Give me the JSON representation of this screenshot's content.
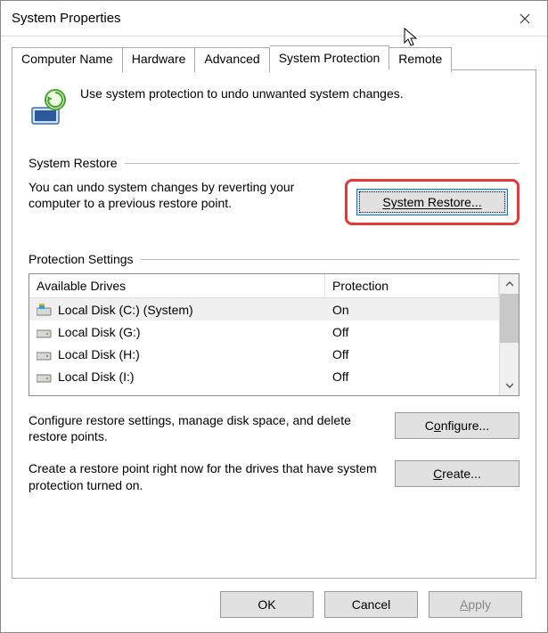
{
  "window": {
    "title": "System Properties"
  },
  "tabs": {
    "items": [
      {
        "label": "Computer Name"
      },
      {
        "label": "Hardware"
      },
      {
        "label": "Advanced"
      },
      {
        "label": "System Protection"
      },
      {
        "label": "Remote"
      }
    ],
    "active_index": 3
  },
  "intro": "Use system protection to undo unwanted system changes.",
  "restore_group": {
    "title": "System Restore",
    "text": "You can undo system changes by reverting your computer to a previous restore point.",
    "button": "System Restore..."
  },
  "protection_group": {
    "title": "Protection Settings",
    "columns": {
      "drives": "Available Drives",
      "protection": "Protection"
    },
    "rows": [
      {
        "name": "Local Disk (C:) (System)",
        "protection": "On",
        "system": true
      },
      {
        "name": "Local Disk (G:)",
        "protection": "Off",
        "system": false
      },
      {
        "name": "Local Disk (H:)",
        "protection": "Off",
        "system": false
      },
      {
        "name": "Local Disk (I:)",
        "protection": "Off",
        "system": false
      }
    ],
    "configure_text": "Configure restore settings, manage disk space, and delete restore points.",
    "configure_button": "Configure...",
    "create_text": "Create a restore point right now for the drives that have system protection turned on.",
    "create_button": "Create..."
  },
  "footer": {
    "ok": "OK",
    "cancel": "Cancel",
    "apply": "Apply"
  }
}
